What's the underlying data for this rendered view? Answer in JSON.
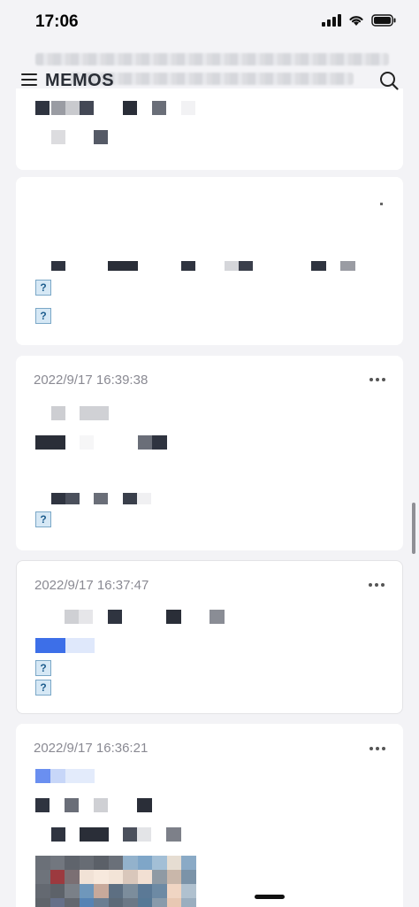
{
  "status_bar": {
    "time": "17:06",
    "signal_icon": "cellular-signal-icon",
    "wifi_icon": "wifi-icon",
    "battery_icon": "battery-icon"
  },
  "header": {
    "title": "MEMOS",
    "menu_icon": "hamburger-menu-icon",
    "search_icon": "search-icon"
  },
  "memos": [
    {
      "date": "",
      "images": 2
    },
    {
      "date": "2022/9/17 16:39:38",
      "images": 1
    },
    {
      "date": "2022/9/17 16:37:47",
      "images": 2
    },
    {
      "date": "2022/9/17 16:36:21",
      "images": 1
    }
  ],
  "placeholder_image_glyph": "?",
  "colors": {
    "background": "#f3f3f6",
    "card": "#ffffff",
    "date_text": "#8a8a93",
    "link_blue": "#3d6fe8"
  }
}
